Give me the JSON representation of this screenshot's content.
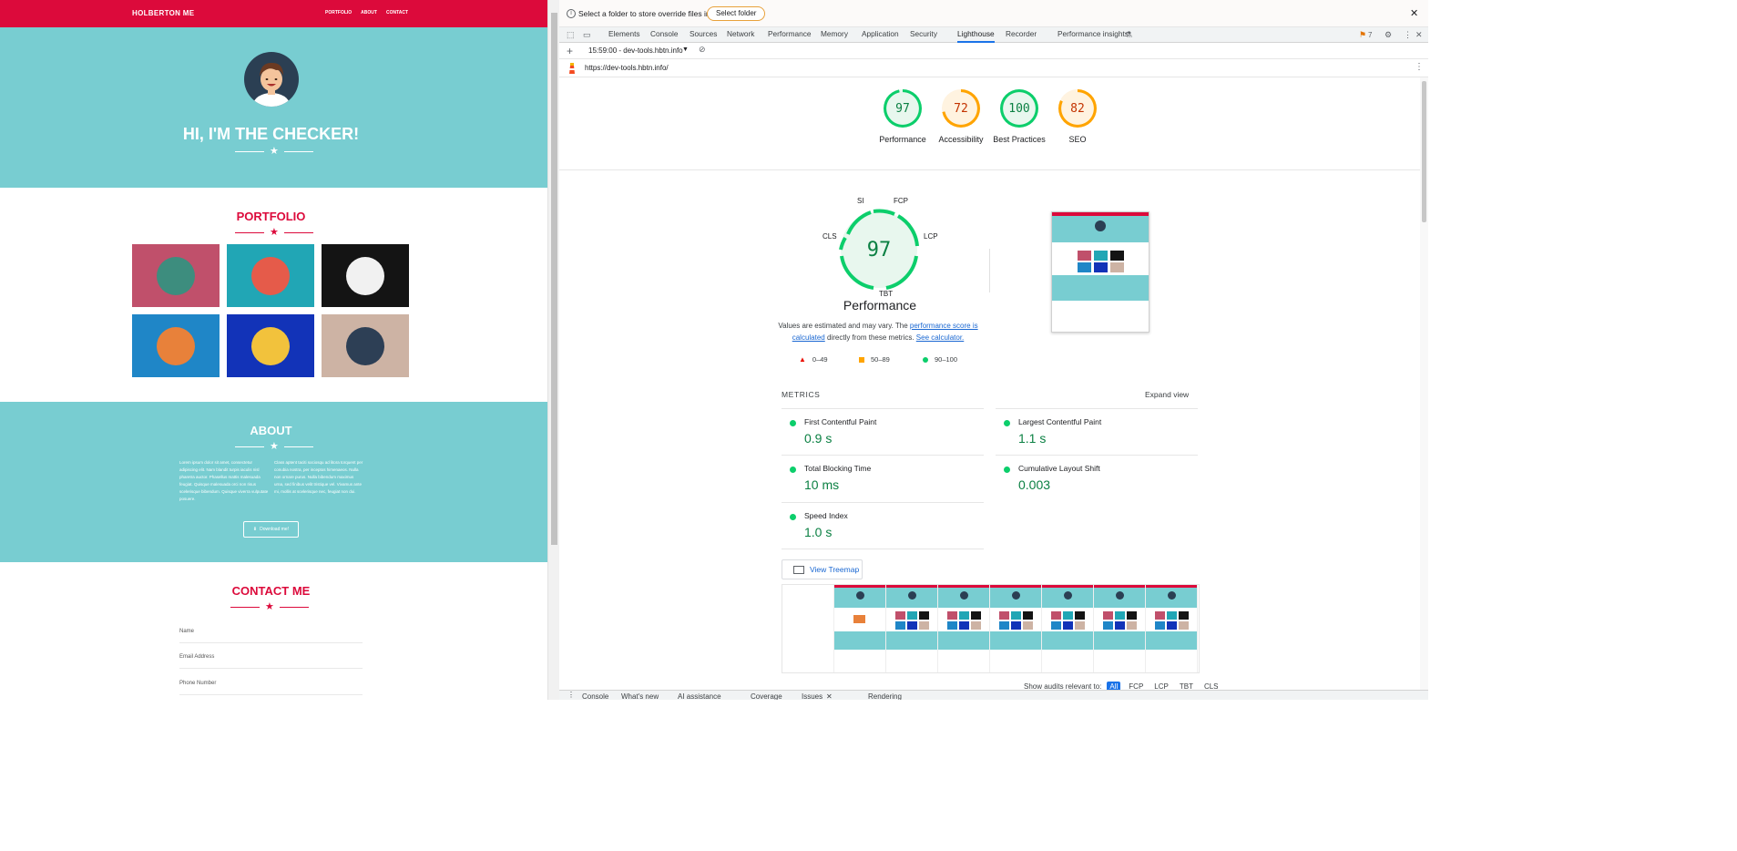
{
  "site": {
    "brand": "HOLBERTON ME",
    "nav": [
      "PORTFOLIO",
      "ABOUT",
      "CONTACT"
    ],
    "hero_title": "HI, I'M THE CHECKER!",
    "portfolio_title": "PORTFOLIO",
    "portfolio_items": [
      {
        "icon": "cabin-icon",
        "bg": "#c0506b",
        "fg": "#3d8d7e"
      },
      {
        "icon": "cake-icon",
        "bg": "#21a6b5",
        "fg": "#e55b4a"
      },
      {
        "icon": "circus-tent-icon",
        "bg": "#141414",
        "fg": "#f1f1f1"
      },
      {
        "icon": "game-controller-icon",
        "bg": "#1f86c7",
        "fg": "#e8813a"
      },
      {
        "icon": "safe-icon",
        "bg": "#1233b8",
        "fg": "#f2c23c"
      },
      {
        "icon": "submarine-icon",
        "bg": "#cdb3a4",
        "fg": "#2d3f55"
      }
    ],
    "about_title": "ABOUT",
    "about_left": "Lorem ipsum dolor sit amet, consectetur adipiscing elit. Nam blandit turpis iaculis nisl pharetra auctor. Phasellus mattis malesuada feugiat. Quisque malesuada orci non risus scelerisque bibendum. Quisque viverra vulputate posuere.",
    "about_right": "Class aptent taciti sociosqu ad litora torquent per conubia nostra, per inceptos himenaeos. Nulla non ornare purus. Nulla bibendum maximus urna, sed finibus velit tristique vel. Vivamus ante mi, mollis at scelerisque nec, feugiat non dui.",
    "download_label": "Download me!",
    "contact_title": "CONTACT ME",
    "contact_fields": [
      "Name",
      "Email Address",
      "Phone Number"
    ],
    "colors": {
      "accent": "#dc0a3b",
      "teal": "#78cdd1"
    }
  },
  "devtools": {
    "notice": "Select a folder to store override files in.",
    "select_folder": "Select folder",
    "tabs": [
      "Elements",
      "Console",
      "Sources",
      "Network",
      "Performance",
      "Memory",
      "Application",
      "Security",
      "Lighthouse",
      "Recorder",
      "Performance insights"
    ],
    "active_tab": "Lighthouse",
    "issues_count": "7",
    "session": "15:59:00 - dev-tools.hbtn.info",
    "url": "https://dev-tools.hbtn.info/",
    "scores": [
      {
        "label": "Performance",
        "value": "97",
        "color": "#0cce6b",
        "text": "#0b8043",
        "bg": "#e8f7ee"
      },
      {
        "label": "Accessibility",
        "value": "72",
        "color": "#ffa400",
        "text": "#c33300",
        "bg": "#fff3e0"
      },
      {
        "label": "Best Practices",
        "value": "100",
        "color": "#0cce6b",
        "text": "#0b8043",
        "bg": "#e8f7ee"
      },
      {
        "label": "SEO",
        "value": "82",
        "color": "#ffa400",
        "text": "#c33300",
        "bg": "#fff3e0"
      }
    ],
    "perf_score": "97",
    "perf_title": "Performance",
    "gauge_labels": {
      "si": "SI",
      "fcp": "FCP",
      "cls": "CLS",
      "lcp": "LCP",
      "tbt": "TBT"
    },
    "note_prefix": "Values are estimated and may vary. The ",
    "note_link1": "performance score is calculated",
    "note_mid": " directly from these metrics. ",
    "note_link2": "See calculator.",
    "legend": [
      "0–49",
      "50–89",
      "90–100"
    ],
    "metrics_label": "METRICS",
    "expand_view": "Expand view",
    "metrics": [
      {
        "name": "First Contentful Paint",
        "value": "0.9 s"
      },
      {
        "name": "Largest Contentful Paint",
        "value": "1.1 s"
      },
      {
        "name": "Total Blocking Time",
        "value": "10 ms"
      },
      {
        "name": "Cumulative Layout Shift",
        "value": "0.003"
      },
      {
        "name": "Speed Index",
        "value": "1.0 s"
      }
    ],
    "treemap": "View Treemap",
    "show_audits": "Show audits relevant to:",
    "audit_filters": [
      "All",
      "FCP",
      "LCP",
      "TBT",
      "CLS"
    ],
    "drawer_tabs": [
      "Console",
      "What's new",
      "AI assistance",
      "Coverage",
      "Issues",
      "Rendering"
    ]
  }
}
